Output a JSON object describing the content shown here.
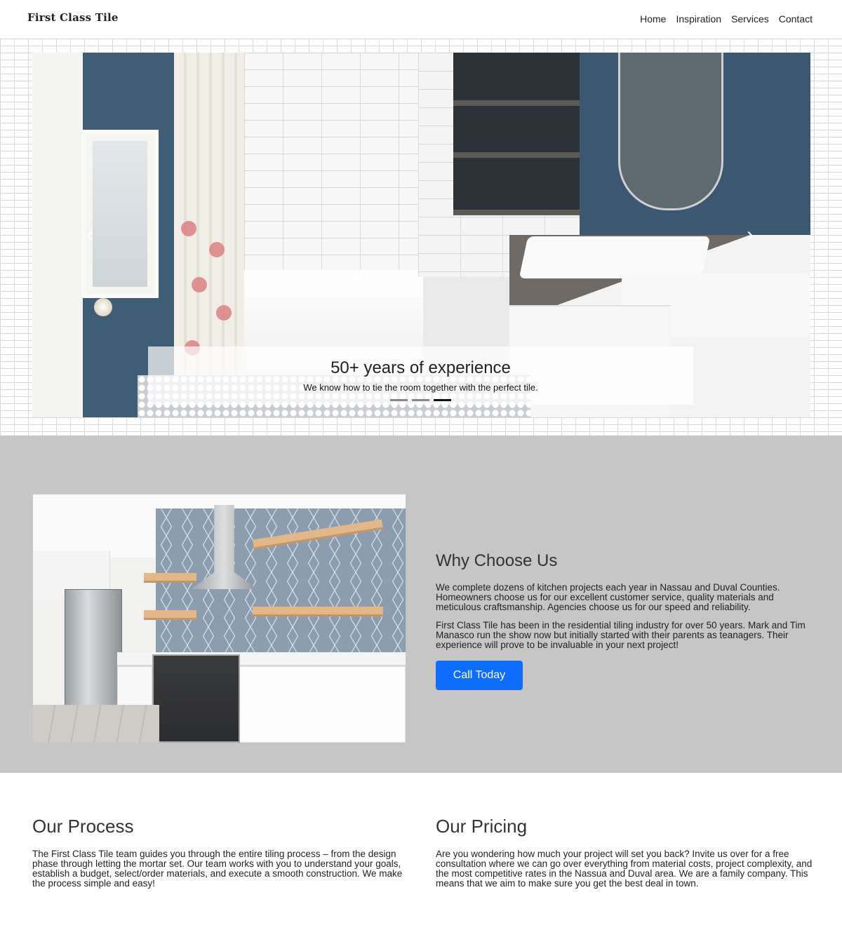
{
  "brand": "First Class Tile",
  "nav": {
    "items": [
      "Home",
      "Inspiration",
      "Services",
      "Contact"
    ]
  },
  "hero": {
    "caption_title": "50+ years of experience",
    "caption_text": "We know how to tie the room together with the perfect tile.",
    "prev_icon": "‹",
    "next_icon": "›",
    "slide_count": 3,
    "active_slide": 3
  },
  "why": {
    "title": "Why Choose Us",
    "para1": "We complete dozens of kitchen projects each year in Nassau and Duval Counties. Homeowners choose us for our excellent customer service, quality materials and meticulous craftsmanship. Agencies choose us for our speed and reliability.",
    "para2": "First Class Tile has been in the residential tiling industry for over 50 years. Mark and Tim Manasco run the show now but initially started with their parents as teanagers. Their experience will prove to be invaluable in your next project!",
    "cta": "Call Today"
  },
  "process": {
    "title": "Our Process",
    "text": "The First Class Tile team guides you through the entire tiling process – from the design phase through letting the mortar set. Our team works with you to understand your goals, establish a budget, select/order materials, and execute a smooth construction. We make the process simple and easy!"
  },
  "pricing": {
    "title": "Our Pricing",
    "text": "Are you wondering how much your project will set you back? Invite us over for a free consultation where we can go over everything from material costs, project complexity, and the most competitive rates in the Nassua and Duval area. We are a family company. This means that we aim to make sure you get the best deal in town."
  },
  "colors": {
    "accent": "#0d6efd",
    "section_gray": "#c6c6c6"
  }
}
